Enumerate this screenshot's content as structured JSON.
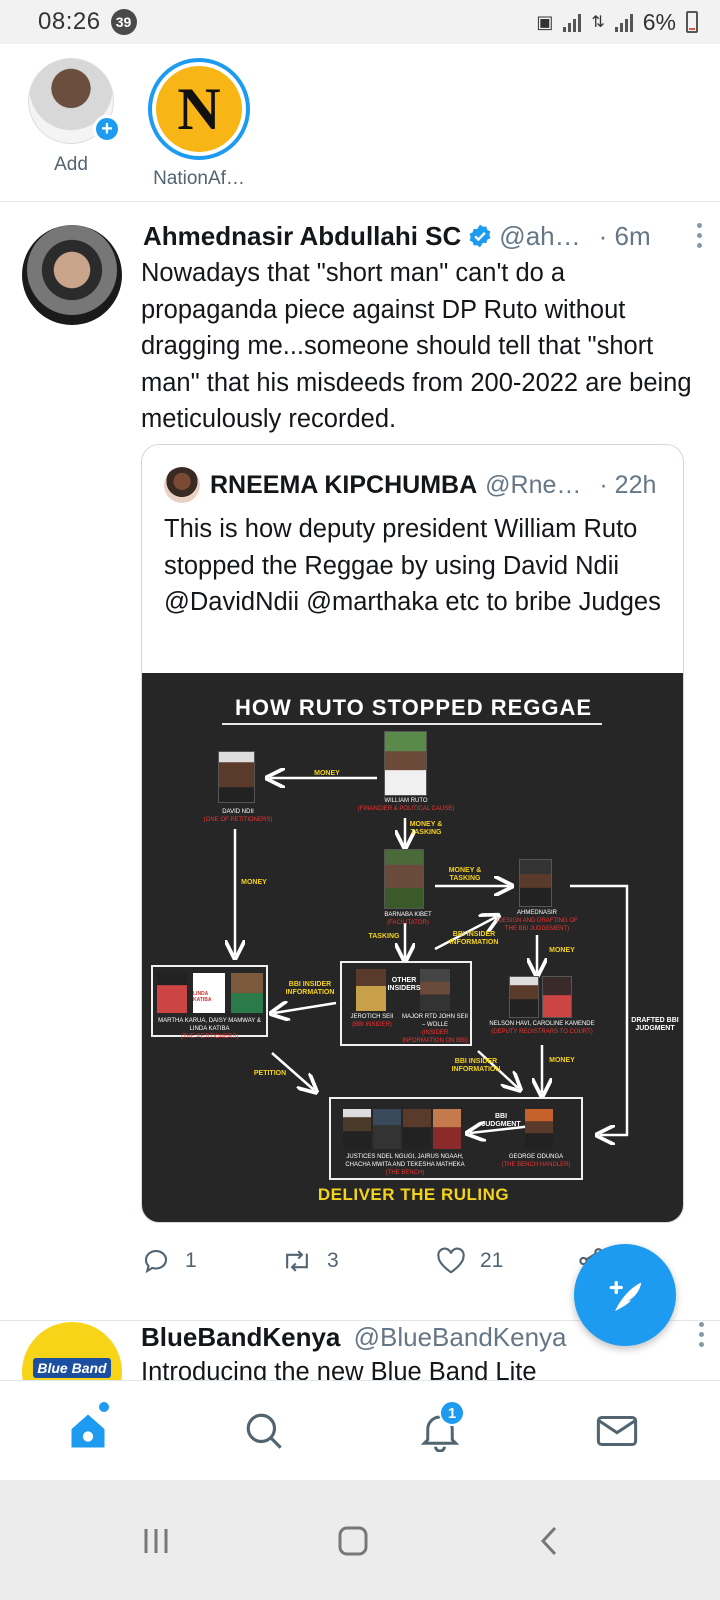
{
  "status_bar": {
    "time": "08:26",
    "notification_count": "39",
    "battery": "6%"
  },
  "fleets": [
    {
      "label": "Add"
    },
    {
      "label": "NationAf…",
      "initial": "N"
    }
  ],
  "tweet": {
    "name": "Ahmednasir Abdullahi SC",
    "handle": "@ah…",
    "time": "· 6m",
    "text": "Nowadays that \"short man\" can't do a propaganda piece against DP Ruto without dragging me...someone should tell that \"short man\" that his misdeeds from 200-2022 are being meticulously recorded.",
    "quoted": {
      "name": "RNEEMA KIPCHUMBA",
      "handle": "@Rne…",
      "time": "· 22h",
      "text": "This is how deputy president William Ruto stopped the Reggae by using David Ndii @DavidNdii @marthaka etc to bribe Judges",
      "image": {
        "title": "HOW RUTO STOPPED REGGAE",
        "bottom": "DELIVER THE RULING",
        "nodes": {
          "ruto": {
            "name": "WILLIAM RUTO",
            "role": "(FINANCIER & POLITICAL CAUSE)"
          },
          "ndii": {
            "name": "DAVID NDII",
            "role": "(ONE OF PETITIONERS)"
          },
          "kibet": {
            "name": "BARNABA KIBET",
            "role": "(FACILITATOR)"
          },
          "ahmednasir": {
            "name": "AHMEDNASIR",
            "role": "(DESIGN AND DRAFTING OF THE BBI JUDGEMENT)"
          },
          "petitioners": {
            "name": "MARTHA KARUA, DAISY MAMWAY & LINDA KATIBA",
            "role": "(THE PETITIONERS)",
            "logo": "LINDA KATIBA"
          },
          "insiders": {
            "name_left": "JEROTICH SEII",
            "name_right": "MAJOR RTD JOHN SEII – WOLLE",
            "role_left": "(BBI INSIDER)",
            "role_right": "(INSIDER INFORMATION ON BBI)",
            "tag": "OTHER INSIDERS"
          },
          "ouko": {
            "name": "NELSON HAVI, CAROLINE KAMENDE",
            "role": "(DEPUTY REGISTRARS TO COURT)"
          },
          "judges": {
            "name": "JUSTICES NDEL NGUGI, JAIRUS NGAAH, CHACHA MWITA AND TEKESHA MATHEKA",
            "role": "(THE BENCH)"
          },
          "odunga": {
            "name": "GEORGE ODUNGA",
            "role": "(THE BENCH HANDLER)"
          }
        },
        "edge_labels": {
          "money_ndii": "MONEY",
          "money_tasking_1": "MONEY & TASKING",
          "money_tasking_2": "MONEY & TASKING",
          "money_down": "MONEY",
          "tasking": "TASKING",
          "bbi_insider_1": "BBI INSIDER INFORMATION",
          "bbi_insider_2": "BBI INSIDER INFORMATION",
          "bbi_insider_3": "BBI INSIDER INFORMATION",
          "money_right": "MONEY",
          "money_bottom": "MONEY",
          "petition": "PETITION",
          "bbi_judgment": "BBI JUDGMENT",
          "drafted": "DRAFTED BBI JUDGMENT"
        }
      }
    },
    "stats": {
      "replies": "1",
      "retweets": "3",
      "likes": "21"
    }
  },
  "next_tweet": {
    "name": "BlueBandKenya",
    "handle": "@BlueBandKenya",
    "text": "Introducing the new Blue Band Lite",
    "avatar_logo": "Blue Band"
  },
  "bottom_nav": {
    "notification_badge": "1"
  },
  "colors": {
    "accent": "#1d9bf0",
    "chalkboard": "#262626",
    "chalk_yellow": "#f5d21c",
    "chalk_red": "#e33333"
  }
}
